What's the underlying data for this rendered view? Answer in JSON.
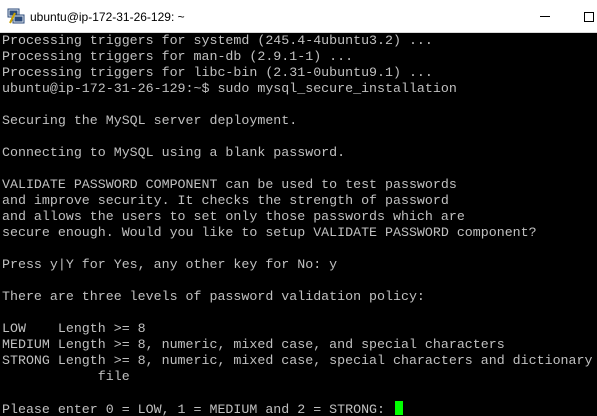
{
  "window": {
    "title": "ubuntu@ip-172-31-26-129: ~",
    "icon": "putty-icon"
  },
  "terminal": {
    "lines": [
      "Processing triggers for systemd (245.4-4ubuntu3.2) ...",
      "Processing triggers for man-db (2.9.1-1) ...",
      "Processing triggers for libc-bin (2.31-0ubuntu9.1) ...",
      "ubuntu@ip-172-31-26-129:~$ sudo mysql_secure_installation",
      "",
      "Securing the MySQL server deployment.",
      "",
      "Connecting to MySQL using a blank password.",
      "",
      "VALIDATE PASSWORD COMPONENT can be used to test passwords",
      "and improve security. It checks the strength of password",
      "and allows the users to set only those passwords which are",
      "secure enough. Would you like to setup VALIDATE PASSWORD component?",
      "",
      "Press y|Y for Yes, any other key for No: y",
      "",
      "There are three levels of password validation policy:",
      "",
      "LOW    Length >= 8",
      "MEDIUM Length >= 8, numeric, mixed case, and special characters",
      "STRONG Length >= 8, numeric, mixed case, special characters and dictionary",
      "            file",
      "",
      "Please enter 0 = LOW, 1 = MEDIUM and 2 = STRONG: "
    ],
    "cursor_color": "#00ff00",
    "text_color": "#c0c0c0",
    "background_color": "#000000"
  }
}
